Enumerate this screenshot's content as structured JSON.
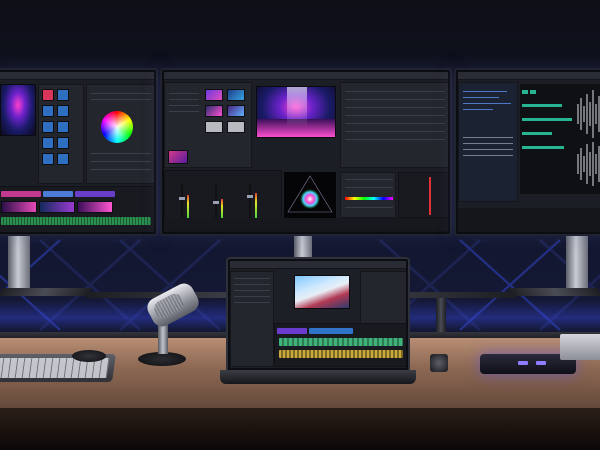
{
  "scene": {
    "description_hidden": false,
    "accent_colors": {
      "wall_glow": "#3b4cff",
      "stage_pink": "#ff3fd0",
      "stage_purple": "#6a22c9",
      "desk_wood": "#b88e74",
      "dock_led": "#8f7dff"
    }
  },
  "monitors": {
    "left": {
      "app": "video-editor"
    },
    "center": {
      "app": "video-editor"
    },
    "right": {
      "app": "audio-editor"
    }
  },
  "laptop": {
    "app": "video-editor"
  },
  "desk_items": {
    "microphone": "microphone",
    "keyboard": "keyboard",
    "mouse": "mouse",
    "dock": "docking-station"
  }
}
